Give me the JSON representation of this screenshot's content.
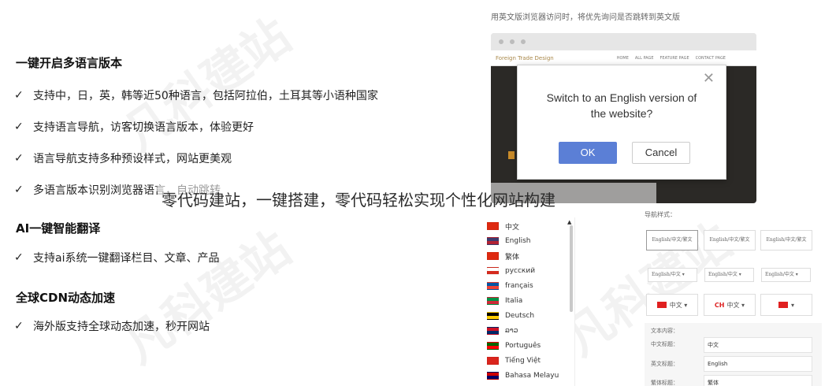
{
  "left": {
    "section1_title": "一键开启多语言版本",
    "section1_items": [
      "支持中，日，英，韩等近50种语言，包括阿拉伯，土耳其等小语种国家",
      "支持语言导航，访客切换语言版本，体验更好",
      "语言导航支持多种预设样式，网站更美观",
      "多语言版本识别浏览器语言，自动跳转"
    ],
    "section2_title": "AI一键智能翻译",
    "section2_items": [
      "支持ai系统一键翻译栏目、文章、产品"
    ],
    "section3_title": "全球CDN动态加速",
    "section3_items": [
      "海外版支持全球动态加速，秒开网站"
    ],
    "check_glyph": "✓"
  },
  "right": {
    "caption": "用英文版浏览器访问时，将优先询问是否跳转到英文版",
    "site_brand": "Foreign Trade Design",
    "site_nav": [
      "HOME",
      "ALL PAGE",
      "FEATURE PAGE",
      "CONTACT PAGE"
    ],
    "dialog": {
      "message_line1": "Switch to an English version of",
      "message_line2": "the website?",
      "ok_label": "OK",
      "cancel_label": "Cancel",
      "close_glyph": "✕"
    },
    "style_header": "导航样式：",
    "style_boxes": [
      "English/中文/繁文",
      "English/中文/繁文",
      "English/中文/繁文"
    ],
    "style_dropdowns": [
      "English/中文 ▾",
      "English/中文 ▾",
      "English/中文 ▾"
    ],
    "flag_buttons": [
      "中文 ▾",
      "中文 ▾",
      "▾"
    ],
    "flag_button_prefix": "CH",
    "content_header": "文本内容：",
    "content_rows": [
      {
        "label": "中文标题：",
        "value": "中文"
      },
      {
        "label": "英文标题：",
        "value": "English"
      },
      {
        "label": "繁体标题：",
        "value": "繁体"
      }
    ]
  },
  "languages": [
    {
      "name": "中文",
      "colors": [
        "#de2910",
        "#de2910"
      ]
    },
    {
      "name": "English",
      "colors": [
        "#3c3b6e",
        "#b22234"
      ]
    },
    {
      "name": "繁体",
      "colors": [
        "#de2910",
        "#de2910"
      ]
    },
    {
      "name": "русский",
      "colors": [
        "#ffffff",
        "#d52b1e"
      ]
    },
    {
      "name": "français",
      "colors": [
        "#0055a4",
        "#ef4135"
      ]
    },
    {
      "name": "Italia",
      "colors": [
        "#009246",
        "#ce2b37"
      ]
    },
    {
      "name": "Deutsch",
      "colors": [
        "#000000",
        "#ffce00"
      ]
    },
    {
      "name": "ລາວ",
      "colors": [
        "#ce1126",
        "#002868"
      ]
    },
    {
      "name": "Português",
      "colors": [
        "#006600",
        "#ff0000"
      ]
    },
    {
      "name": "Tiếng Việt",
      "colors": [
        "#da251d",
        "#da251d"
      ]
    },
    {
      "name": "Bahasa Melayu",
      "colors": [
        "#cc0001",
        "#010066"
      ]
    }
  ],
  "overlay_text": "零代码建站，一键搭建，零代码轻松实现个性化网站构建",
  "scroll_up_glyph": "▲"
}
